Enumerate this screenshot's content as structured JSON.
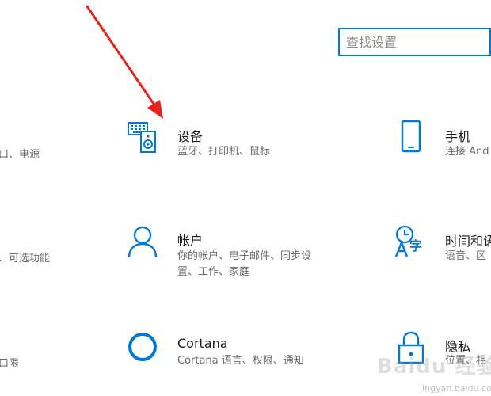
{
  "search": {
    "placeholder": "查找设置"
  },
  "left_column": {
    "row1_desc": "口、电源",
    "row2_desc": "、可选功能",
    "row3_desc": "口限"
  },
  "tiles": {
    "devices": {
      "title": "设备",
      "desc": "蓝牙、打印机、鼠标",
      "icon": "devices-icon"
    },
    "phone": {
      "title": "手机",
      "desc": "连接 And",
      "icon": "phone-icon"
    },
    "accounts": {
      "title": "帐户",
      "desc_line1": "你的帐户、电子邮件、同步设",
      "desc_line2": "置、工作、家庭",
      "icon": "person-icon"
    },
    "time_language": {
      "title": "时间和语",
      "desc": "语音、区",
      "icon": "time-language-icon"
    },
    "cortana": {
      "title": "Cortana",
      "desc": "Cortana 语言、权限、通知",
      "icon": "cortana-icon"
    },
    "privacy": {
      "title": "隐私",
      "desc": "位置、相",
      "icon": "lock-icon"
    }
  },
  "annotation": {
    "arrow_color": "#e8211c"
  },
  "watermark": {
    "main": "Baidu 经验",
    "sub": "jingyan.baidu.com"
  },
  "colors": {
    "accent": "#0078d7",
    "title_text": "#1a1a1a",
    "desc_text": "#6b6b6b"
  }
}
